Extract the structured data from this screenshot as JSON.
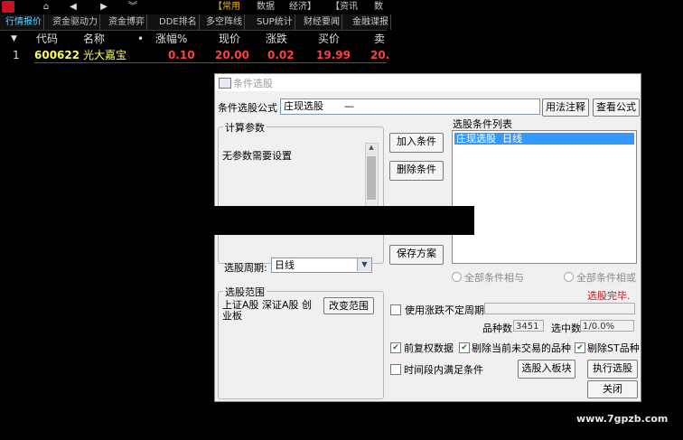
{
  "topbar": {
    "menus": [
      "【常用",
      "数据",
      "经济】",
      "【资讯",
      "数"
    ]
  },
  "tabs": [
    "行情报价",
    "资金驱动力",
    "资金博弈",
    "DDE排名",
    "多空阵线",
    "SUP统计",
    "财经要闻",
    "金融谍报"
  ],
  "table": {
    "headers": [
      "代码",
      "名称",
      "•",
      "涨幅%",
      "现价",
      "涨跌",
      "买价",
      "卖"
    ],
    "rows": [
      {
        "idx": "1",
        "code": "600622",
        "name": "光大嘉宝",
        "pct": "0.10",
        "price": "20.00",
        "change": "0.02",
        "bid": "19.99",
        "ask": "20."
      }
    ]
  },
  "dialog": {
    "title": "条件选股",
    "formula_label": "条件选股公式",
    "formula_value": "庄现选股",
    "formula_dash": "—",
    "usage_button": "用法注释",
    "view_formula_button": "查看公式",
    "params_group": "计算参数",
    "params_text": "无参数需要设置",
    "add_condition": "加入条件",
    "delete_condition": "删除条件",
    "save_plan": "保存方案",
    "condition_list_label": "选股条件列表",
    "condition_item": "庄现选股  日线",
    "period_label": "选股周期:",
    "period_value": "日线",
    "radio_and": "全部条件相与",
    "radio_or": "全部条件相或",
    "status": "选股完毕.",
    "range_group": "选股范围",
    "range_text": "上证A股 深证A股 创业板",
    "change_range": "改变范围",
    "use_indefinite": "使用涨跌不定周期",
    "variety_label": "品种数",
    "variety_value": "3451",
    "selected_label": "选中数",
    "selected_value": "1/0.0%",
    "prev_restore": "前复权数据",
    "exclude_untraded": "剔除当前未交易的品种",
    "exclude_st": "剔除ST品种",
    "time_range": "时间段内满足条件",
    "to_block": "选股入板块",
    "execute": "执行选股",
    "close": "关闭"
  },
  "watermark": "www.7gpzb.com",
  "colors": {
    "accent_tab": "#66ccff",
    "code_yellow": "#ffff55",
    "value_red": "#ff4040",
    "selection": "#3399ff",
    "status_red": "#d01010"
  }
}
